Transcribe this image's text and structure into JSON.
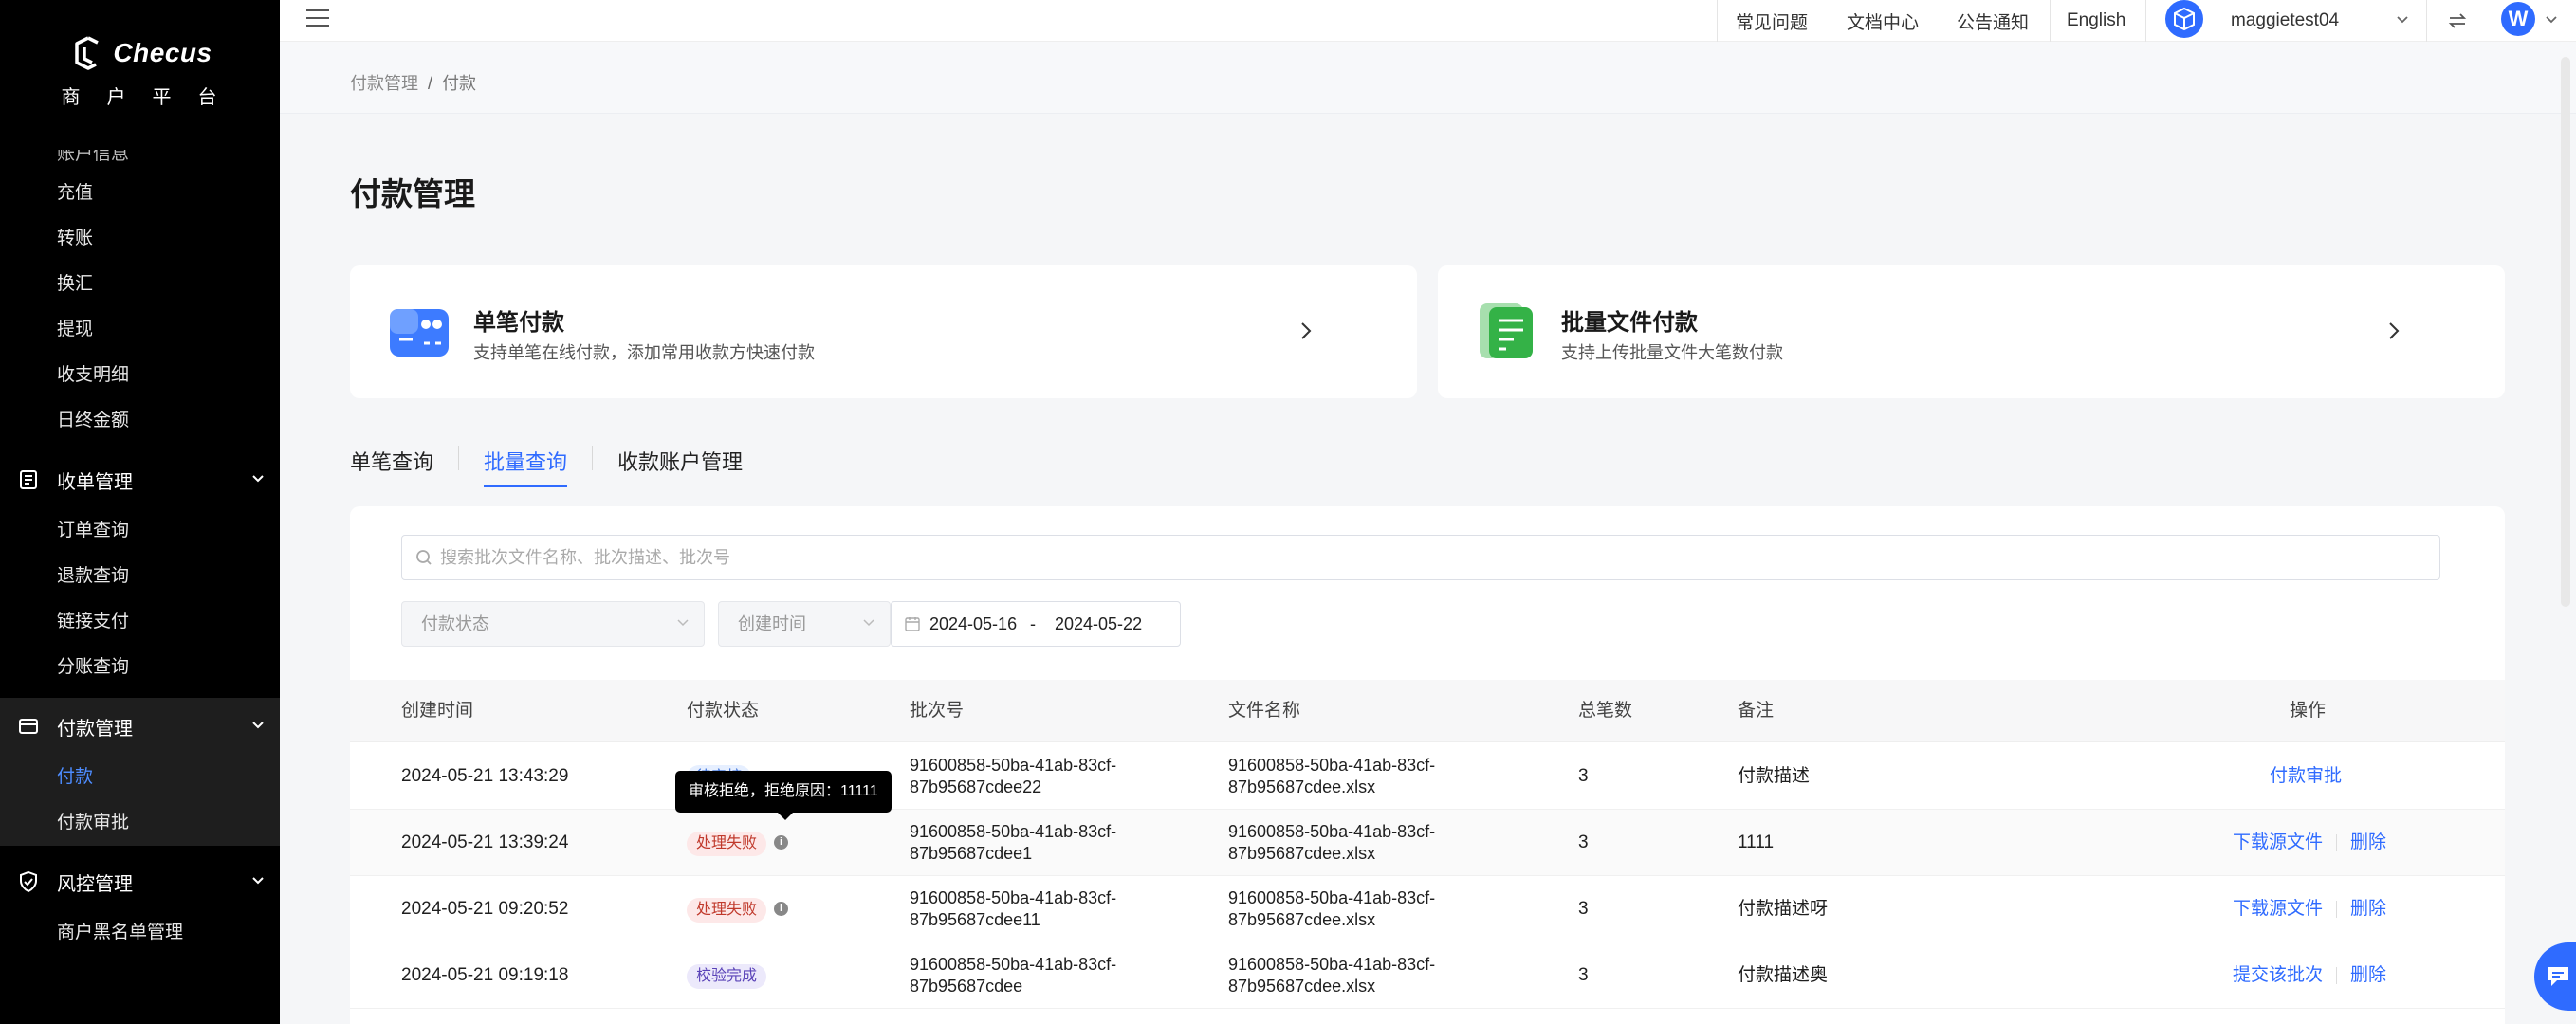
{
  "brand": {
    "name": "Checus",
    "subtitle": "商户平台"
  },
  "sidebar": {
    "partial_item": "账户信息",
    "items_top": [
      "充值",
      "转账",
      "换汇",
      "提现",
      "收支明细",
      "日终金额"
    ],
    "group_receipt": {
      "label": "收单管理",
      "items": [
        "订单查询",
        "退款查询",
        "链接支付",
        "分账查询"
      ]
    },
    "group_payment": {
      "label": "付款管理",
      "items": [
        "付款",
        "付款审批"
      ],
      "active_item": "付款"
    },
    "group_risk": {
      "label": "风控管理",
      "items": [
        "商户黑名单管理"
      ]
    }
  },
  "header": {
    "links": [
      "常见问题",
      "文档中心",
      "公告通知",
      "English"
    ],
    "username": "maggietest04",
    "avatar_letter": "W"
  },
  "breadcrumb": {
    "parent": "付款管理",
    "separator": "/",
    "current": "付款"
  },
  "page_title": "付款管理",
  "cards": [
    {
      "title": "单笔付款",
      "desc": "支持单笔在线付款，添加常用收款方快速付款"
    },
    {
      "title": "批量文件付款",
      "desc": "支持上传批量文件大笔数付款"
    }
  ],
  "tabs": [
    {
      "label": "单笔查询",
      "active": false
    },
    {
      "label": "批量查询",
      "active": true
    },
    {
      "label": "收款账户管理",
      "active": false
    }
  ],
  "filters": {
    "search_placeholder": "搜索批次文件名称、批次描述、批次号",
    "status_placeholder": "付款状态",
    "time_type": "创建时间",
    "date_start": "2024-05-16",
    "date_sep": "-",
    "date_end": "2024-05-22"
  },
  "table": {
    "headers": [
      "创建时间",
      "付款状态",
      "批次号",
      "文件名称",
      "总笔数",
      "备注",
      "操作"
    ],
    "rows": [
      {
        "created": "2024-05-21 13:43:29",
        "status": "待审核",
        "status_kind": "pending",
        "batch_l1": "91600858-50ba-41ab-83cf-",
        "batch_l2": "87b95687cdee22",
        "file_l1": "91600858-50ba-41ab-83cf-",
        "file_l2": "87b95687cdee.xlsx",
        "count": "3",
        "note": "付款描述",
        "actions": [
          "付款审批"
        ]
      },
      {
        "created": "2024-05-21 13:39:24",
        "status": "处理失败",
        "status_kind": "fail",
        "batch_l1": "91600858-50ba-41ab-83cf-",
        "batch_l2": "87b95687cdee1",
        "file_l1": "91600858-50ba-41ab-83cf-",
        "file_l2": "87b95687cdee.xlsx",
        "count": "3",
        "note": "1111",
        "actions": [
          "下载源文件",
          "删除"
        ]
      },
      {
        "created": "2024-05-21 09:20:52",
        "status": "处理失败",
        "status_kind": "fail",
        "batch_l1": "91600858-50ba-41ab-83cf-",
        "batch_l2": "87b95687cdee11",
        "file_l1": "91600858-50ba-41ab-83cf-",
        "file_l2": "87b95687cdee.xlsx",
        "count": "3",
        "note": "付款描述呀",
        "actions": [
          "下载源文件",
          "删除"
        ]
      },
      {
        "created": "2024-05-21 09:19:18",
        "status": "校验完成",
        "status_kind": "ok",
        "batch_l1": "91600858-50ba-41ab-83cf-",
        "batch_l2": "87b95687cdee",
        "file_l1": "91600858-50ba-41ab-83cf-",
        "file_l2": "87b95687cdee.xlsx",
        "count": "3",
        "note": "付款描述奥",
        "actions": [
          "提交该批次",
          "删除"
        ]
      }
    ]
  },
  "tooltip": "审核拒绝，拒绝原因：11111",
  "info_glyph": "i",
  "colors": {
    "accent": "#2f6bff",
    "sidebar_bg": "#000000",
    "fail": "#c0392b",
    "ok": "#5a43b8"
  },
  "icons": [
    "menu-icon",
    "switch-icon",
    "chevron-down-icon",
    "search-icon",
    "calendar-icon",
    "card-payment-icon",
    "file-payment-icon",
    "chat-icon"
  ]
}
